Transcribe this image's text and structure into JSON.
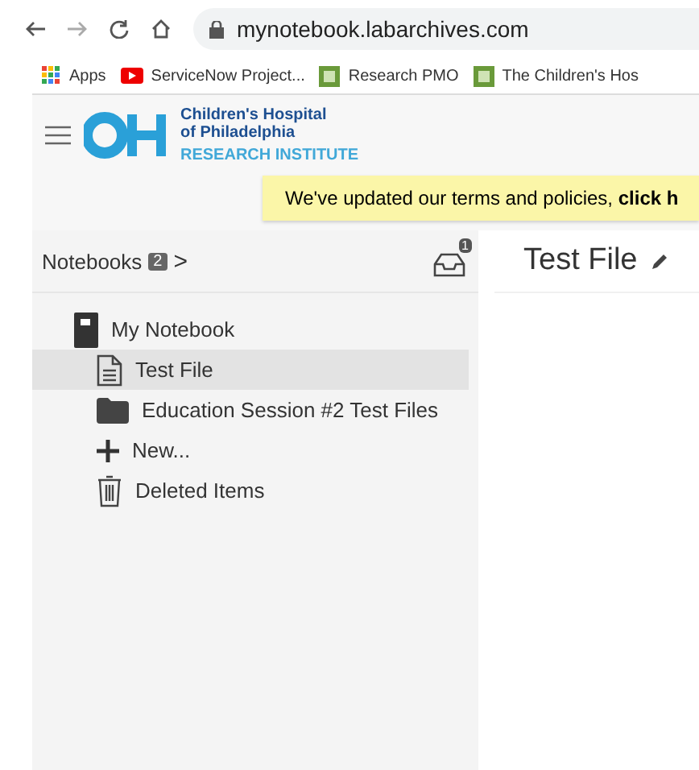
{
  "browser": {
    "url": "mynotebook.labarchives.com",
    "bookmarks": [
      {
        "kind": "apps",
        "label": "Apps"
      },
      {
        "kind": "video",
        "label": "ServiceNow Project..."
      },
      {
        "kind": "site",
        "label": "Research PMO"
      },
      {
        "kind": "site",
        "label": "The Children's Hos"
      }
    ]
  },
  "logo": {
    "line1": "Children's Hospital",
    "line2": "of Philadelphia",
    "line3": "RESEARCH INSTITUTE"
  },
  "banner": "We've updated our terms and policies, **click h**",
  "sidebar": {
    "title": "Notebooks",
    "count": "2",
    "chevron": ">",
    "inbox_count": "1",
    "items": [
      {
        "kind": "notebook",
        "label": "My Notebook",
        "selected": false,
        "children": [
          {
            "kind": "page",
            "label": "Test File",
            "selected": true
          },
          {
            "kind": "folder",
            "label": "Education Session #2 Test Files",
            "selected": false
          },
          {
            "kind": "new",
            "label": "New...",
            "selected": false
          },
          {
            "kind": "trash",
            "label": "Deleted Items",
            "selected": false
          }
        ]
      }
    ]
  },
  "page": {
    "title": "Test File"
  }
}
